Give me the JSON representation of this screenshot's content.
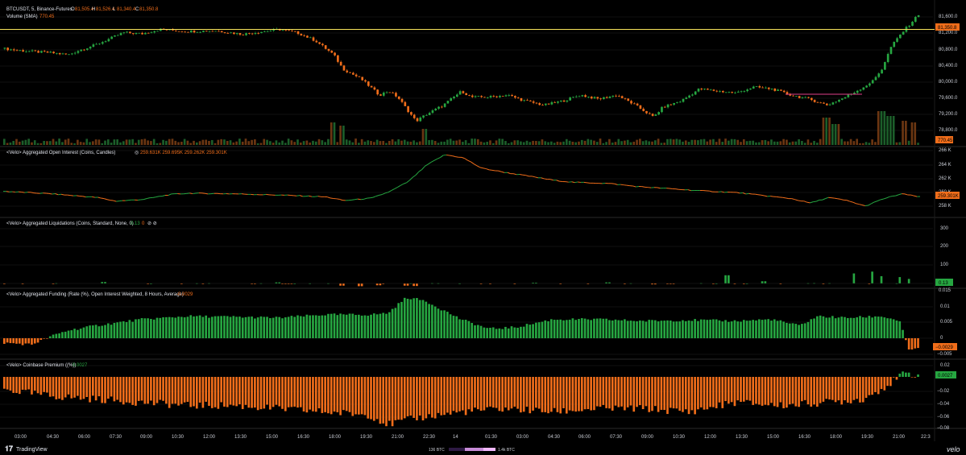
{
  "header": {
    "symbol_line": "BTCUSDT, 5, Binance-Futures",
    "ohlc": [
      {
        "k": "O",
        "v": "81,505.4"
      },
      {
        "k": "H",
        "v": "81,526.4"
      },
      {
        "k": "L",
        "v": "81,340.4"
      },
      {
        "k": "C",
        "v": "81,350.8"
      }
    ],
    "volume_label": "Volume (SMA)",
    "volume_value": "770.45"
  },
  "colors": {
    "up": "#26a641",
    "down": "#f06d1a",
    "price_line": "#f7e35b",
    "background": "#000000",
    "grid": "#1a1a1a",
    "axis_text": "#c9ccd4",
    "tag_fill": "#f06d1a",
    "tag_fill_up": "#26a641"
  },
  "panes": {
    "price": {
      "ticks": [
        "81,600.0",
        "81,200.0",
        "80,800.0",
        "80,400.0",
        "80,000.0",
        "79,600.0",
        "79,200.0",
        "78,800.0"
      ],
      "last_tag": "81,350.8",
      "volume_tag": "770.45"
    },
    "oi": {
      "title": "<Velo> Aggregated Open Interest (Coins, Candles)",
      "values_prefix": "◎",
      "values": "259.631K 259.695K 259.262K 259.301K",
      "ticks": [
        "266 K",
        "264 K",
        "262 K",
        "260 K",
        "258 K"
      ],
      "last_tag": "259.301K"
    },
    "liq": {
      "title": "<Velo> Aggregated Liquidations (Coins, Standard, None, 0)",
      "values": "0.13",
      "values_extra": "0",
      "icons": "⊘ ⊘",
      "ticks": [
        "300",
        "200",
        "100"
      ],
      "last_tag": "0.13"
    },
    "funding": {
      "title": "<Velo> Aggregated Funding (Rate (%), Open Interest Weighted, 8 Hours, Average)",
      "value": "-0.0029",
      "ticks": [
        "0.01",
        "0.005",
        "0",
        "−0.005"
      ],
      "top_cut_tick": "0.015",
      "last_tag": "−0.0029"
    },
    "premium": {
      "title": "<Velo> Coinbase Premium ((%))",
      "value": "0.0027",
      "ticks": [
        "0.02",
        "−0.02",
        "−0.04",
        "−0.06",
        "−0.08"
      ],
      "last_tag": "0.0027"
    }
  },
  "time_axis": [
    "03:00",
    "04:30",
    "06:00",
    "07:30",
    "09:00",
    "10:30",
    "12:00",
    "13:30",
    "15:00",
    "16:30",
    "18:00",
    "19:30",
    "21:00",
    "22:30",
    "14",
    "01:30",
    "03:00",
    "04:30",
    "06:00",
    "07:30",
    "09:00",
    "10:30",
    "12:00",
    "13:30",
    "15:00",
    "16:30",
    "18:00",
    "19:30",
    "21:00",
    "22:3"
  ],
  "footer": {
    "brand": "TradingView",
    "scale_left": "136 BTC",
    "scale_right": "1.4k BTC",
    "velo": "velo"
  },
  "chart_data": [
    {
      "type": "candlestick",
      "title": "BTCUSDT, 5, Binance-Futures",
      "ylim": [
        78600,
        81800
      ],
      "horizontal_line": 81230,
      "price_path": [
        [
          0,
          80750
        ],
        [
          0.01,
          80720
        ],
        [
          0.03,
          80680
        ],
        [
          0.05,
          80650
        ],
        [
          0.07,
          80600
        ],
        [
          0.08,
          80700
        ],
        [
          0.1,
          80850
        ],
        [
          0.12,
          81050
        ],
        [
          0.13,
          81150
        ],
        [
          0.15,
          81120
        ],
        [
          0.17,
          81230
        ],
        [
          0.2,
          81180
        ],
        [
          0.23,
          81200
        ],
        [
          0.26,
          81110
        ],
        [
          0.29,
          81200
        ],
        [
          0.3,
          81230
        ],
        [
          0.32,
          81150
        ],
        [
          0.34,
          80950
        ],
        [
          0.36,
          80600
        ],
        [
          0.37,
          80250
        ],
        [
          0.39,
          80000
        ],
        [
          0.41,
          79600
        ],
        [
          0.42,
          79700
        ],
        [
          0.43,
          79550
        ],
        [
          0.45,
          78950
        ],
        [
          0.46,
          79100
        ],
        [
          0.48,
          79350
        ],
        [
          0.5,
          79700
        ],
        [
          0.51,
          79550
        ],
        [
          0.53,
          79550
        ],
        [
          0.55,
          79600
        ],
        [
          0.57,
          79450
        ],
        [
          0.59,
          79350
        ],
        [
          0.61,
          79450
        ],
        [
          0.63,
          79600
        ],
        [
          0.65,
          79500
        ],
        [
          0.67,
          79600
        ],
        [
          0.69,
          79350
        ],
        [
          0.71,
          79050
        ],
        [
          0.72,
          79300
        ],
        [
          0.74,
          79450
        ],
        [
          0.76,
          79750
        ],
        [
          0.78,
          79700
        ],
        [
          0.8,
          79650
        ],
        [
          0.82,
          79800
        ],
        [
          0.84,
          79750
        ],
        [
          0.86,
          79600
        ],
        [
          0.88,
          79500
        ],
        [
          0.9,
          79350
        ],
        [
          0.92,
          79550
        ],
        [
          0.94,
          79800
        ],
        [
          0.95,
          79950
        ],
        [
          0.96,
          80250
        ],
        [
          0.97,
          80800
        ],
        [
          0.98,
          81100
        ],
        [
          0.99,
          81350
        ],
        [
          1,
          81600
        ]
      ],
      "volume_spikes": [
        [
          0.36,
          0.55
        ],
        [
          0.37,
          0.45
        ],
        [
          0.46,
          0.35
        ],
        [
          0.9,
          0.7
        ],
        [
          0.91,
          0.5
        ],
        [
          0.96,
          0.9
        ],
        [
          0.97,
          0.75
        ],
        [
          0.985,
          0.6
        ],
        [
          0.995,
          0.55
        ]
      ],
      "volume_tag": 770.45
    },
    {
      "type": "line",
      "title": "<Velo> Aggregated Open Interest (Coins, Candles)",
      "ylim": [
        257000,
        267000
      ],
      "points": [
        [
          0,
          260200
        ],
        [
          0.05,
          259800
        ],
        [
          0.1,
          259200
        ],
        [
          0.12,
          258600
        ],
        [
          0.15,
          258900
        ],
        [
          0.18,
          259700
        ],
        [
          0.2,
          259900
        ],
        [
          0.25,
          259800
        ],
        [
          0.3,
          259600
        ],
        [
          0.35,
          259300
        ],
        [
          0.37,
          258700
        ],
        [
          0.4,
          259100
        ],
        [
          0.42,
          260200
        ],
        [
          0.44,
          261800
        ],
        [
          0.46,
          264500
        ],
        [
          0.48,
          266200
        ],
        [
          0.5,
          265700
        ],
        [
          0.52,
          264000
        ],
        [
          0.55,
          263200
        ],
        [
          0.58,
          262500
        ],
        [
          0.6,
          262000
        ],
        [
          0.62,
          261700
        ],
        [
          0.66,
          261500
        ],
        [
          0.69,
          261000
        ],
        [
          0.72,
          260700
        ],
        [
          0.76,
          260300
        ],
        [
          0.8,
          260000
        ],
        [
          0.83,
          259500
        ],
        [
          0.86,
          259000
        ],
        [
          0.88,
          258300
        ],
        [
          0.9,
          259200
        ],
        [
          0.92,
          258700
        ],
        [
          0.94,
          257800
        ],
        [
          0.96,
          259000
        ],
        [
          0.98,
          259800
        ],
        [
          1,
          259300
        ]
      ]
    },
    {
      "type": "bar",
      "title": "<Velo> Aggregated Liquidations (Coins, Standard, None, 0)",
      "ylim": [
        -20,
        330
      ],
      "spikes": [
        [
          0.11,
          8
        ],
        [
          0.3,
          6
        ],
        [
          0.37,
          -12
        ],
        [
          0.39,
          -15
        ],
        [
          0.41,
          -10
        ],
        [
          0.44,
          -12
        ],
        [
          0.45,
          -14
        ],
        [
          0.58,
          4
        ],
        [
          0.66,
          6
        ],
        [
          0.71,
          -5
        ],
        [
          0.79,
          45
        ],
        [
          0.83,
          12
        ],
        [
          0.93,
          55
        ],
        [
          0.95,
          65
        ],
        [
          0.96,
          40
        ],
        [
          0.98,
          35
        ],
        [
          0.99,
          25
        ]
      ],
      "last": 0.13
    },
    {
      "type": "bar",
      "title": "<Velo> Aggregated Funding (Rate (%), Open Interest Weighted, 8 Hours, Average)",
      "ylim": [
        -0.007,
        0.016
      ],
      "points": [
        [
          0,
          -0.0015
        ],
        [
          0.03,
          -0.002
        ],
        [
          0.05,
          0.0005
        ],
        [
          0.07,
          0.0025
        ],
        [
          0.1,
          0.004
        ],
        [
          0.15,
          0.006
        ],
        [
          0.2,
          0.007
        ],
        [
          0.25,
          0.0068
        ],
        [
          0.3,
          0.0065
        ],
        [
          0.35,
          0.0075
        ],
        [
          0.4,
          0.0075
        ],
        [
          0.42,
          0.008
        ],
        [
          0.44,
          0.013
        ],
        [
          0.46,
          0.012
        ],
        [
          0.48,
          0.009
        ],
        [
          0.5,
          0.006
        ],
        [
          0.53,
          0.003
        ],
        [
          0.56,
          0.0035
        ],
        [
          0.6,
          0.006
        ],
        [
          0.65,
          0.006
        ],
        [
          0.7,
          0.0055
        ],
        [
          0.75,
          0.0058
        ],
        [
          0.8,
          0.0055
        ],
        [
          0.84,
          0.006
        ],
        [
          0.87,
          0.004
        ],
        [
          0.89,
          0.007
        ],
        [
          0.92,
          0.0065
        ],
        [
          0.96,
          0.007
        ],
        [
          0.98,
          0.0055
        ],
        [
          0.99,
          -0.004
        ],
        [
          1,
          -0.0029
        ]
      ]
    },
    {
      "type": "bar",
      "title": "<Velo> Coinbase Premium ((%))",
      "ylim": [
        -0.09,
        0.025
      ],
      "points": [
        [
          0,
          -0.02
        ],
        [
          0.05,
          -0.03
        ],
        [
          0.1,
          -0.035
        ],
        [
          0.15,
          -0.04
        ],
        [
          0.2,
          -0.045
        ],
        [
          0.25,
          -0.045
        ],
        [
          0.3,
          -0.05
        ],
        [
          0.35,
          -0.055
        ],
        [
          0.4,
          -0.06
        ],
        [
          0.42,
          -0.075
        ],
        [
          0.45,
          -0.065
        ],
        [
          0.5,
          -0.055
        ],
        [
          0.55,
          -0.05
        ],
        [
          0.6,
          -0.055
        ],
        [
          0.65,
          -0.05
        ],
        [
          0.7,
          -0.05
        ],
        [
          0.75,
          -0.055
        ],
        [
          0.8,
          -0.04
        ],
        [
          0.85,
          -0.045
        ],
        [
          0.9,
          -0.04
        ],
        [
          0.94,
          -0.035
        ],
        [
          0.97,
          -0.01
        ],
        [
          0.985,
          0.005
        ],
        [
          1,
          0.0027
        ]
      ]
    }
  ]
}
